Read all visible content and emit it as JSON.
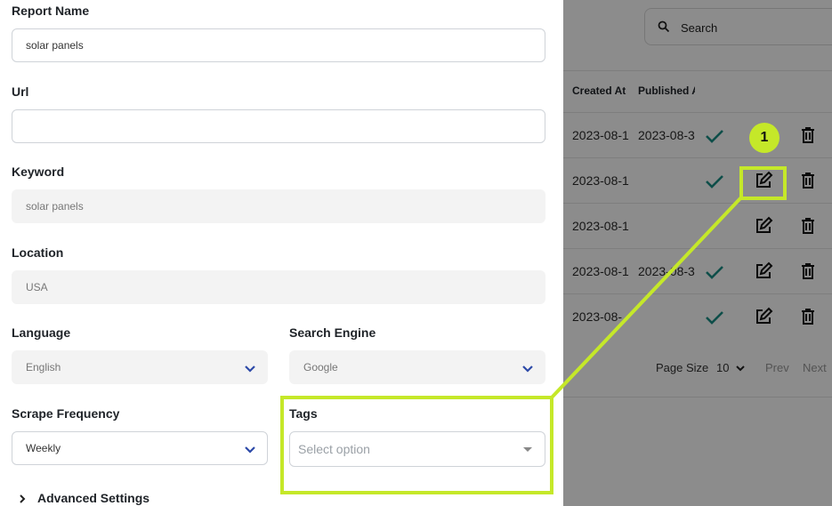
{
  "form": {
    "report_name": {
      "label": "Report Name",
      "value": "solar panels"
    },
    "url": {
      "label": "Url",
      "value": ""
    },
    "keyword": {
      "label": "Keyword",
      "value": "solar panels"
    },
    "location": {
      "label": "Location",
      "value": "USA"
    },
    "language": {
      "label": "Language",
      "value": "English"
    },
    "search_engine": {
      "label": "Search Engine",
      "value": "Google"
    },
    "scrape_frequency": {
      "label": "Scrape Frequency",
      "value": "Weekly"
    },
    "tags": {
      "label": "Tags",
      "placeholder": "Select option"
    },
    "advanced_settings": "Advanced Settings"
  },
  "search": {
    "label": "Search"
  },
  "table": {
    "headers": [
      "Created At",
      "Published A"
    ],
    "rows": [
      {
        "created": "2023-08-1",
        "published": "2023-08-3"
      },
      {
        "created": "2023-08-1",
        "published": ""
      },
      {
        "created": "2023-08-1",
        "published": ""
      },
      {
        "created": "2023-08-1",
        "published": "2023-08-3"
      },
      {
        "created": "2023-08-",
        "published": ""
      }
    ]
  },
  "pagination": {
    "page_size_label": "Page Size",
    "page_size": "10",
    "prev": "Prev",
    "next": "Next"
  },
  "annotation": {
    "step": "1"
  },
  "colors": {
    "highlight": "#c5e829",
    "check": "#1a8f86"
  }
}
